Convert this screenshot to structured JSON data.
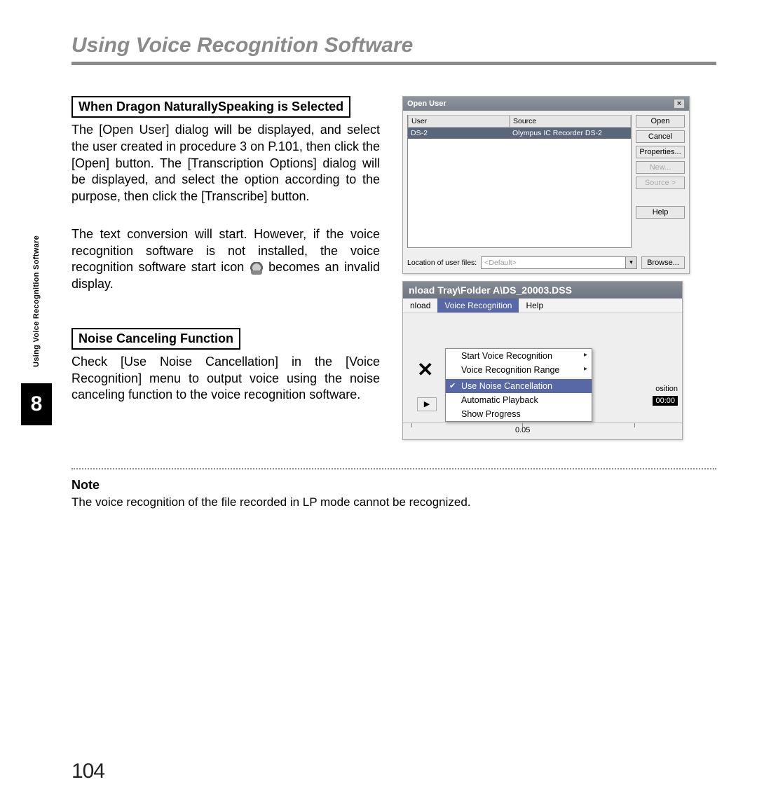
{
  "page_title": "Using Voice Recognition Software",
  "sidebar": {
    "label": "Using Voice Recognition Software",
    "chapter": "8"
  },
  "section1": {
    "heading": "When Dragon NaturallySpeaking is Selected",
    "para1": "The [Open User] dialog will be displayed, and select the user created in procedure 3 on P.101, then click the [Open] button.  The [Transcription Options] dialog will be displayed, and select the option according to the purpose, then click the [Transcribe] button.",
    "para2a": "The text conversion will start.  However, if the voice recognition software is not installed, the voice recognition software start icon ",
    "para2b": " becomes an invalid display."
  },
  "section2": {
    "heading": "Noise Canceling Function",
    "para": "Check [Use Noise Cancellation] in the [Voice Recognition] menu to output voice using the noise canceling function to the voice recognition software."
  },
  "open_user_dialog": {
    "title": "Open User",
    "col_user": "User",
    "col_source": "Source",
    "row_user": "DS-2",
    "row_source": "Olympus IC Recorder DS-2",
    "buttons": {
      "open": "Open",
      "cancel": "Cancel",
      "properties": "Properties...",
      "new": "New...",
      "source": "Source >",
      "help": "Help",
      "browse": "Browse..."
    },
    "footer_label": "Location of user files:",
    "footer_value": "<Default>"
  },
  "menu_shot": {
    "titlebar": "nload Tray\\Folder A\\DS_20003.DSS",
    "menubar": {
      "left": "nload",
      "active": "Voice Recognition",
      "right": "Help"
    },
    "items": {
      "start": "Start Voice Recognition",
      "range": "Voice Recognition Range",
      "noise": "Use Noise Cancellation",
      "auto": "Automatic Playback",
      "progress": "Show Progress"
    },
    "right_label": "osition",
    "right_time": "00:00",
    "ruler_value": "0.05"
  },
  "note": {
    "heading": "Note",
    "text": "The voice recognition of the file recorded in LP mode cannot be recognized."
  },
  "page_number": "104"
}
